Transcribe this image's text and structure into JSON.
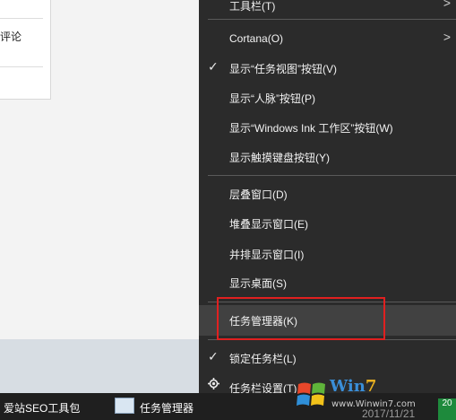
{
  "background": {
    "panel_text": "评论"
  },
  "menu": {
    "top_partial": {
      "label": "工具栏(T)",
      "arrow": ">"
    },
    "items": [
      {
        "label": "Cortana(O)",
        "checked": false,
        "arrow": ">"
      },
      {
        "label": "显示“任务视图”按钮(V)",
        "checked": true
      },
      {
        "label": "显示“人脉”按钮(P)",
        "checked": false
      },
      {
        "label": "显示“Windows Ink 工作区”按钮(W)",
        "checked": false
      },
      {
        "label": "显示触摸键盘按钮(Y)",
        "checked": false
      },
      {
        "label": "层叠窗口(D)",
        "checked": false
      },
      {
        "label": "堆叠显示窗口(E)",
        "checked": false
      },
      {
        "label": "并排显示窗口(I)",
        "checked": false
      },
      {
        "label": "显示桌面(S)",
        "checked": false
      },
      {
        "label": "任务管理器(K)",
        "checked": false,
        "highlighted": true
      },
      {
        "label": "锁定任务栏(L)",
        "checked": true
      },
      {
        "label": "任务栏设置(T)",
        "icon": "gear-icon"
      }
    ],
    "check_glyph": "✓"
  },
  "taskbar": {
    "items": [
      {
        "label": "爱站SEO工具包"
      },
      {
        "label": "任务管理器",
        "icon": "task-manager-icon"
      }
    ],
    "date": "2017/11/21",
    "tag": "20"
  },
  "watermark": {
    "brand_w": "Win",
    "brand_7": "7",
    "url": "www.Winwin7.com"
  },
  "colors": {
    "menu_bg": "#2b2b2b",
    "highlight": "#414141",
    "annotation_red": "#e02020",
    "taskbar_bg": "#1f1f1f"
  }
}
